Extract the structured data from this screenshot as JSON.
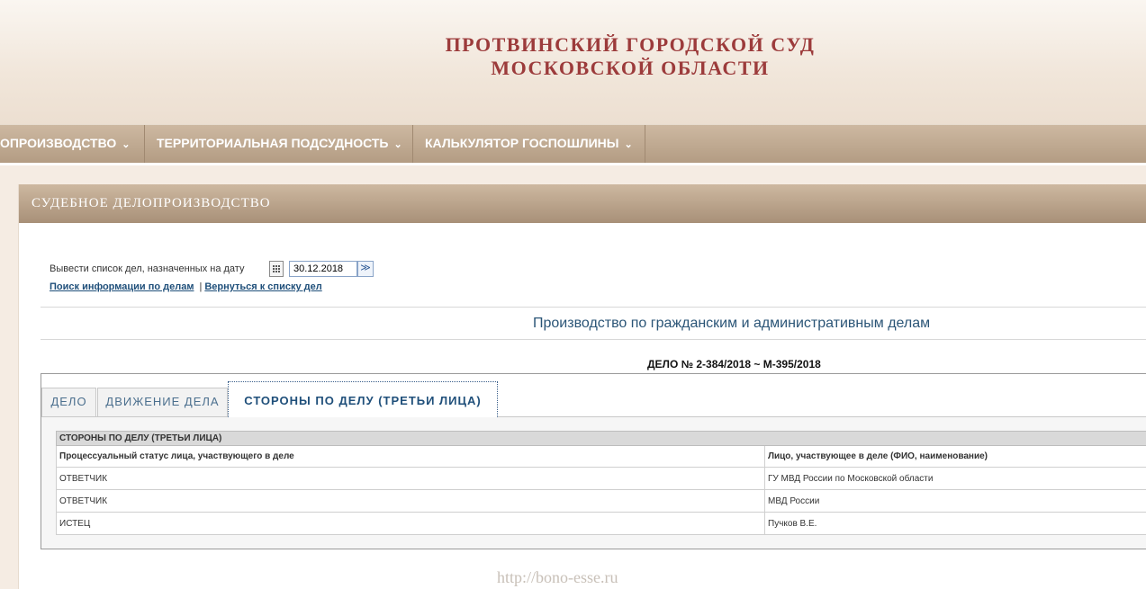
{
  "header": {
    "title_line1": "ПРОТВИНСКИЙ ГОРОДСКОЙ СУД",
    "title_line2": "МОСКОВСКОЙ ОБЛАСТИ"
  },
  "nav": {
    "items": [
      {
        "label": "ОПРОИЗВОДСТВО"
      },
      {
        "label": "ТЕРРИТОРИАЛЬНАЯ ПОДСУДНОСТЬ"
      },
      {
        "label": "КАЛЬКУЛЯТОР ГОСПОШЛИНЫ"
      }
    ]
  },
  "section": {
    "title": "СУДЕБНОЕ ДЕЛОПРОИЗВОДСТВО"
  },
  "date_filter": {
    "label": "Вывести список дел, назначенных на дату",
    "value": "30.12.2018",
    "go_glyph": "≫"
  },
  "links": {
    "search": "Поиск информации по делам",
    "separator": "|",
    "back": "Вернуться к списку дел"
  },
  "proceeding_title": "Производство по гражданским и административным делам",
  "case_number": "ДЕЛО № 2-384/2018 ~ М-395/2018",
  "tabs": [
    {
      "label": "ДЕЛО",
      "active": false
    },
    {
      "label": "ДВИЖЕНИЕ ДЕЛА",
      "active": false
    },
    {
      "label": "СТОРОНЫ ПО ДЕЛУ (ТРЕТЬИ ЛИЦА)",
      "active": true
    }
  ],
  "parties_table": {
    "caption": "СТОРОНЫ ПО ДЕЛУ (ТРЕТЬИ ЛИЦА)",
    "headers": [
      "Процессуальный статус лица, участвующего в деле",
      "Лицо, участвующее в деле (ФИО, наименование)"
    ],
    "rows": [
      [
        "ОТВЕТЧИК",
        "ГУ МВД России по Московской области"
      ],
      [
        "ОТВЕТЧИК",
        "МВД России"
      ],
      [
        "ИСТЕЦ",
        "Пучков В.Е."
      ]
    ]
  },
  "watermark": "http://bono-esse.ru"
}
